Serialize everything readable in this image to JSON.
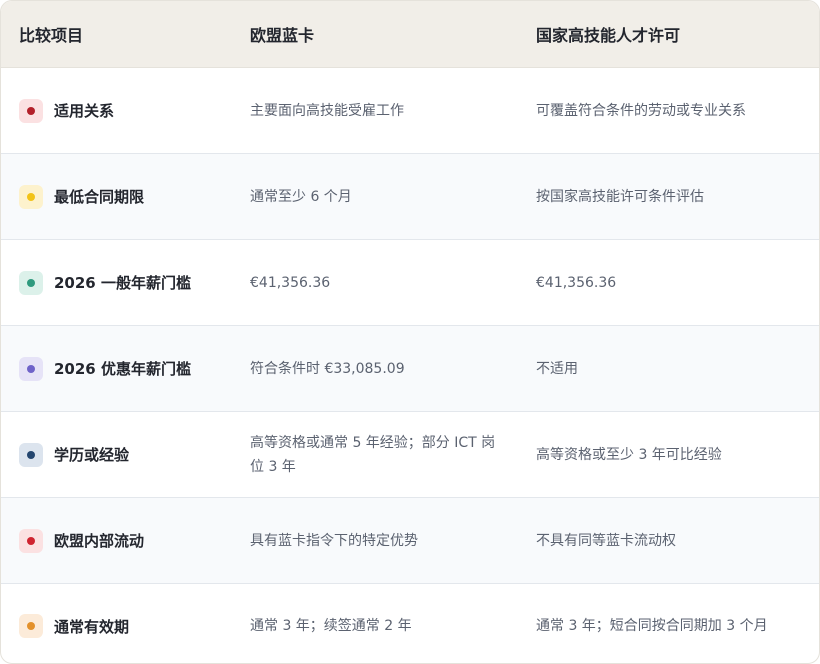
{
  "header": {
    "col1": "比较项目",
    "col2": "欧盟蓝卡",
    "col3": "国家高技能人才许可"
  },
  "rows": [
    {
      "label": "适用关系",
      "bluecard": "主要面向高技能受雇工作",
      "national": "可覆盖符合条件的劳动或专业关系",
      "dot_color": "#b3202a",
      "badge_color": "#fbe1e2"
    },
    {
      "label": "最低合同期限",
      "bluecard": "通常至少 6 个月",
      "national": "按国家高技能许可条件评估",
      "dot_color": "#f2c318",
      "badge_color": "#fdf2cd"
    },
    {
      "label": "2026 一般年薪门槛",
      "bluecard": "€41,356.36",
      "national": "€41,356.36",
      "dot_color": "#2f9a7e",
      "badge_color": "#dcf1ea"
    },
    {
      "label": "2026 优惠年薪门槛",
      "bluecard": "符合条件时 €33,085.09",
      "national": "不适用",
      "dot_color": "#6f63c9",
      "badge_color": "#e6e3f7"
    },
    {
      "label": "学历或经验",
      "bluecard": "高等资格或通常 5 年经验；部分 ICT 岗位 3 年",
      "national": "高等资格或至少 3 年可比经验",
      "dot_color": "#24466f",
      "badge_color": "#dce4ee"
    },
    {
      "label": "欧盟内部流动",
      "bluecard": "具有蓝卡指令下的特定优势",
      "national": "不具有同等蓝卡流动权",
      "dot_color": "#cf2431",
      "badge_color": "#fbe1e2"
    },
    {
      "label": "通常有效期",
      "bluecard": "通常 3 年；续签通常 2 年",
      "national": "通常 3 年；短合同按合同期加 3 个月",
      "dot_color": "#e3912b",
      "badge_color": "#fcebd9"
    }
  ]
}
